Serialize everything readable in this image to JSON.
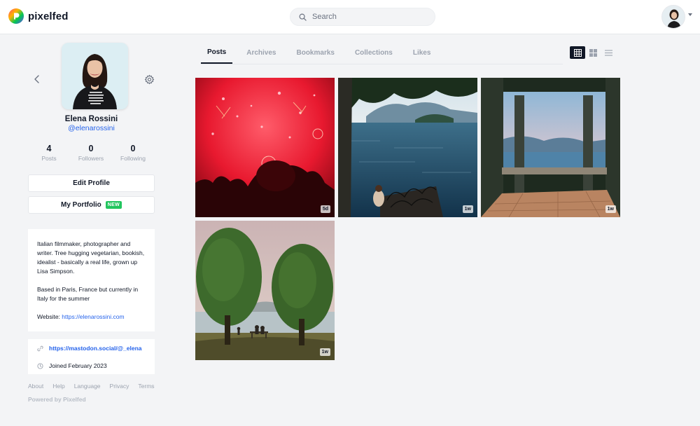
{
  "header": {
    "brand": "pixelfed",
    "search_placeholder": "Search"
  },
  "profile": {
    "display_name": "Elena Rossini",
    "username": "@elenarossini",
    "stats": [
      {
        "value": "4",
        "label": "Posts"
      },
      {
        "value": "0",
        "label": "Followers"
      },
      {
        "value": "0",
        "label": "Following"
      }
    ],
    "edit_profile_label": "Edit Profile",
    "portfolio_label": "My Portfolio",
    "portfolio_badge": "NEW",
    "bio_p1": "Italian filmmaker, photographer and writer. Tree hugging vegetarian, bookish, idealist - basically a real life, grown up Lisa Simpson.",
    "bio_p2": "Based in Paris, France but currently in Italy for the summer",
    "website_label": "Website:",
    "website_url": "https://elenarossini.com",
    "link": "https://mastodon.social/@_elena",
    "joined": "Joined February 2023"
  },
  "tabs": [
    {
      "label": "Posts",
      "active": true
    },
    {
      "label": "Archives"
    },
    {
      "label": "Bookmarks"
    },
    {
      "label": "Collections"
    },
    {
      "label": "Likes"
    }
  ],
  "posts": [
    {
      "time": "5d",
      "scene": "fireworks"
    },
    {
      "time": "1w",
      "scene": "lake-balcony"
    },
    {
      "time": "1w",
      "scene": "loggia-arches"
    },
    {
      "time": "1w",
      "scene": "trees-lakeside"
    }
  ],
  "footer": {
    "links": [
      "About",
      "Help",
      "Language",
      "Privacy",
      "Terms"
    ],
    "powered": "Powered by Pixelfed"
  },
  "colors": {
    "accent_blue": "#2563eb",
    "badge_green": "#22c55e",
    "page_bg": "#f3f4f6"
  },
  "icons": [
    "pixelfed-logo-icon",
    "search-icon",
    "chevron-left-icon",
    "gear-icon",
    "link-icon",
    "clock-icon",
    "grid-icon",
    "masonry-icon",
    "list-icon"
  ]
}
